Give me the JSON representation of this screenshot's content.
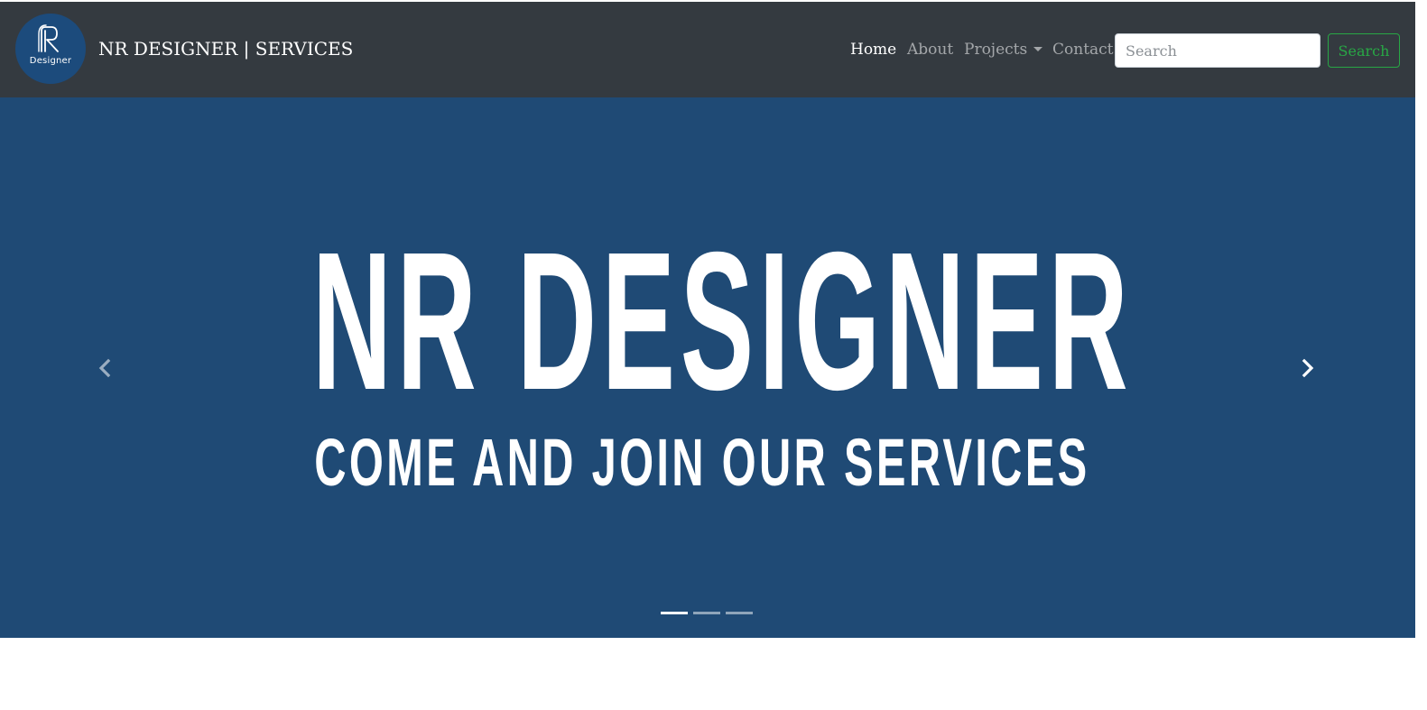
{
  "navbar": {
    "logo_text": "Designer",
    "brand": "NR DESIGNER | SERVICES",
    "links": [
      {
        "label": "Home",
        "active": true
      },
      {
        "label": "About",
        "active": false
      },
      {
        "label": "Projects",
        "active": false,
        "dropdown": true
      },
      {
        "label": "Contact",
        "active": false
      }
    ],
    "search": {
      "placeholder": "Search",
      "value": "",
      "button_label": "Search"
    }
  },
  "carousel": {
    "title": "NR DESIGNER",
    "subtitle": "COME AND JOIN OUR SERVICES",
    "background_color": "#1f4a75",
    "active_slide": 1,
    "slide_count": 3,
    "prev_icon": "chevron-left-icon",
    "next_icon": "chevron-right-icon"
  },
  "colors": {
    "navbar_bg": "#343a40",
    "logo_bg": "#1c4b7c",
    "success": "#28a745"
  }
}
